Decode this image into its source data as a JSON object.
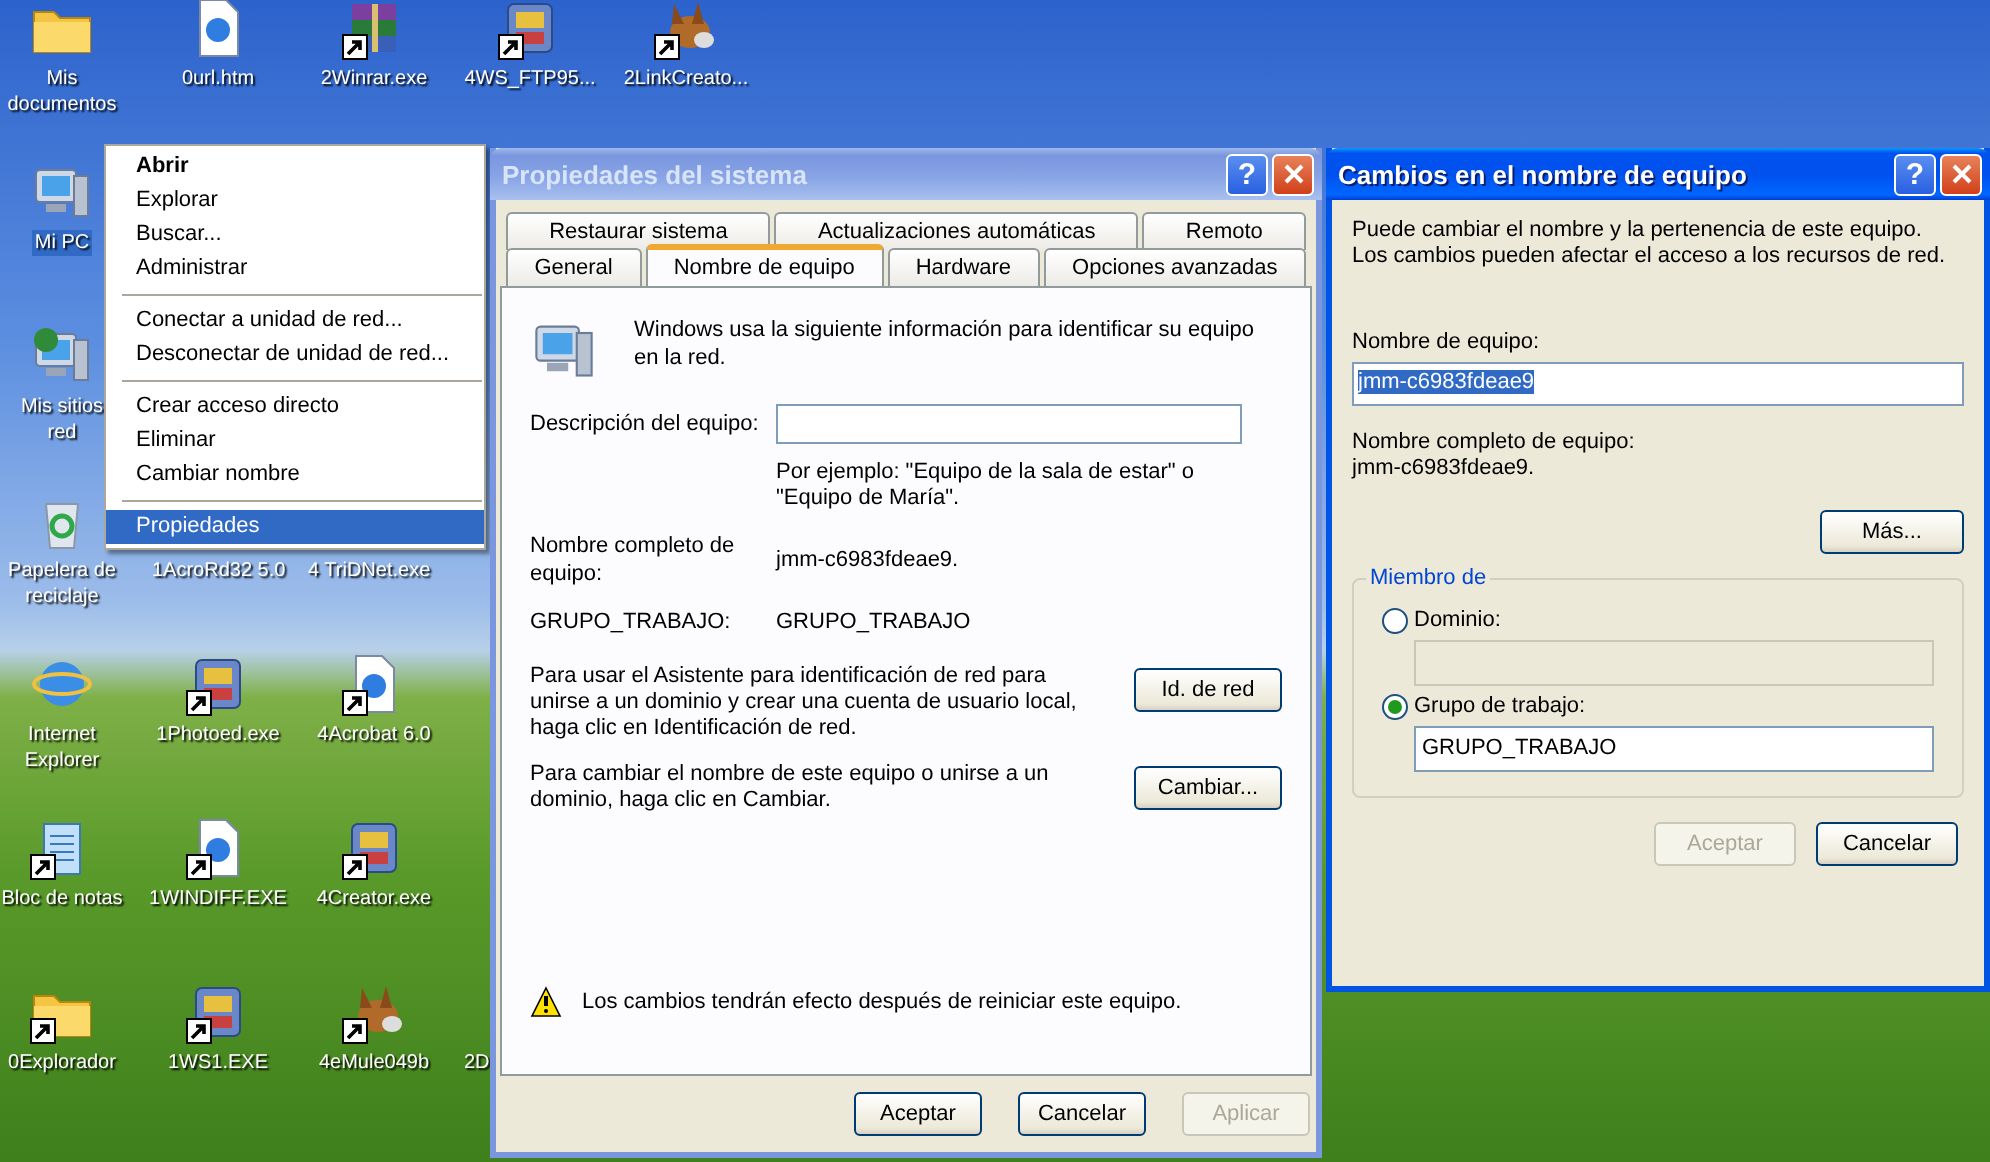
{
  "desktop": {
    "icon_rows": [
      [
        {
          "label_lines": [
            "Mis",
            "documentos"
          ],
          "kind": "folder",
          "shortcut": false,
          "selected": false,
          "covered": false
        },
        {
          "label_lines": [
            "0url.htm"
          ],
          "kind": "document",
          "shortcut": false,
          "selected": false,
          "covered": false
        },
        {
          "label_lines": [
            "2Winrar.exe"
          ],
          "kind": "archive",
          "shortcut": true,
          "selected": false,
          "covered": false
        },
        {
          "label_lines": [
            "4WS_FTP95..."
          ],
          "kind": "program",
          "shortcut": true,
          "selected": false,
          "covered": false
        },
        {
          "label_lines": [
            "2LinkCreato..."
          ],
          "kind": "mule",
          "shortcut": true,
          "selected": false,
          "covered": false
        }
      ],
      [
        {
          "label_lines": [
            "Mi PC"
          ],
          "kind": "computer",
          "shortcut": false,
          "selected": true,
          "covered": false
        }
      ],
      [
        {
          "label_lines": [
            "Mis sitios",
            "red"
          ],
          "kind": "network",
          "shortcut": false,
          "selected": false,
          "covered": false
        }
      ],
      [
        {
          "label_lines": [
            "Papelera de",
            "reciclaje"
          ],
          "kind": "trash",
          "shortcut": false,
          "selected": false,
          "covered": false
        },
        {
          "label_lines": [
            "1AcroRd32 5.0"
          ],
          "selected": false,
          "covered": true
        },
        {
          "label_lines": [
            "4 TriDNet.exe"
          ],
          "selected": false,
          "covered": true
        }
      ],
      [
        {
          "label_lines": [
            "Internet",
            "Explorer"
          ],
          "kind": "globe",
          "shortcut": false,
          "selected": false,
          "covered": false
        },
        {
          "label_lines": [
            "1Photoed.exe"
          ],
          "kind": "program",
          "shortcut": true,
          "selected": false,
          "covered": false
        },
        {
          "label_lines": [
            "4Acrobat 6.0"
          ],
          "kind": "document",
          "shortcut": true,
          "selected": false,
          "covered": false
        }
      ],
      [
        {
          "label_lines": [
            "Bloc de notas"
          ],
          "kind": "notepad",
          "shortcut": true,
          "selected": false,
          "covered": false
        },
        {
          "label_lines": [
            "1WINDIFF.EXE"
          ],
          "kind": "document",
          "shortcut": true,
          "selected": false,
          "covered": false
        },
        {
          "label_lines": [
            "4Creator.exe"
          ],
          "kind": "program",
          "shortcut": true,
          "selected": false,
          "covered": false
        }
      ],
      [
        {
          "label_lines": [
            "0Explorador"
          ],
          "kind": "folder",
          "shortcut": true,
          "selected": false,
          "covered": false
        },
        {
          "label_lines": [
            "1WS1.EXE"
          ],
          "kind": "program",
          "shortcut": true,
          "selected": false,
          "covered": false
        },
        {
          "label_lines": [
            "4eMule049b"
          ],
          "kind": "mule",
          "shortcut": true,
          "selected": false,
          "covered": false
        },
        {
          "label_lines": [
            "2D"
          ],
          "selected": false,
          "covered": true
        }
      ]
    ]
  },
  "context_menu": {
    "groups": [
      [
        {
          "label": "Abrir",
          "default": true,
          "selected": false
        },
        {
          "label": "Explorar",
          "default": false,
          "selected": false
        },
        {
          "label": "Buscar...",
          "default": false,
          "selected": false
        },
        {
          "label": "Administrar",
          "default": false,
          "selected": false
        }
      ],
      [
        {
          "label": "Conectar a unidad de red...",
          "default": false,
          "selected": false
        },
        {
          "label": "Desconectar de unidad de red...",
          "default": false,
          "selected": false
        }
      ],
      [
        {
          "label": "Crear acceso directo",
          "default": false,
          "selected": false
        },
        {
          "label": "Eliminar",
          "default": false,
          "selected": false
        },
        {
          "label": "Cambiar nombre",
          "default": false,
          "selected": false
        }
      ],
      [
        {
          "label": "Propiedades",
          "default": false,
          "selected": true
        }
      ]
    ]
  },
  "system_properties": {
    "title": "Propiedades del sistema",
    "active": false,
    "help_label": "?",
    "tab_rows": [
      [
        {
          "label": "Restaurar sistema",
          "selected": false
        },
        {
          "label": "Actualizaciones automáticas",
          "selected": false
        },
        {
          "label": "Remoto",
          "selected": false
        }
      ],
      [
        {
          "label": "General",
          "selected": false
        },
        {
          "label": "Nombre de equipo",
          "selected": true
        },
        {
          "label": "Hardware",
          "selected": false
        },
        {
          "label": "Opciones avanzadas",
          "selected": false
        }
      ]
    ],
    "panel": {
      "intro": "Windows usa la siguiente información para identificar su equipo en la red.",
      "description_label": "Descripción del equipo:",
      "example": "Por ejemplo: \"Equipo de la sala de estar\" o \"Equipo de María\".",
      "full_name_label": "Nombre completo de equipo:",
      "full_name": "jmm-c6983fdeae9.",
      "workgroup_label": "GRUPO_TRABAJO:",
      "workgroup": "GRUPO_TRABAJO",
      "actions": [
        {
          "text": "Para usar el Asistente para identificación de red para unirse a un dominio y crear una cuenta de usuario local, haga clic en Identificación de red.",
          "button": "Id. de red"
        },
        {
          "text": "Para cambiar el nombre de este equipo o unirse a un dominio, haga clic en Cambiar.",
          "button": "Cambiar..."
        }
      ],
      "warning": "Los cambios tendrán efecto después de reiniciar este equipo."
    },
    "buttons": [
      {
        "label": "Aceptar",
        "disabled": false
      },
      {
        "label": "Cancelar",
        "disabled": false
      },
      {
        "label": "Aplicar",
        "disabled": true
      }
    ]
  },
  "rename_dialog": {
    "title": "Cambios en el nombre de equipo",
    "active": true,
    "help_label": "?",
    "intro": "Puede cambiar el nombre y la pertenencia de este equipo. Los cambios pueden afectar el acceso a los recursos de red.",
    "name_label": "Nombre de equipo:",
    "name_value": "jmm-c6983fdeae9",
    "name_value_selected": true,
    "full_name_label": "Nombre completo de equipo:",
    "full_name": "jmm-c6983fdeae9.",
    "more_button": "Más...",
    "member_legend": "Miembro de",
    "options": [
      {
        "label": "Dominio:",
        "selected": false,
        "disabled": true
      },
      {
        "label": "Grupo de trabajo:",
        "selected": true,
        "disabled": false,
        "value": "GRUPO_TRABAJO"
      }
    ],
    "buttons": [
      {
        "label": "Aceptar",
        "disabled": true
      },
      {
        "label": "Cancelar",
        "disabled": false
      }
    ]
  }
}
